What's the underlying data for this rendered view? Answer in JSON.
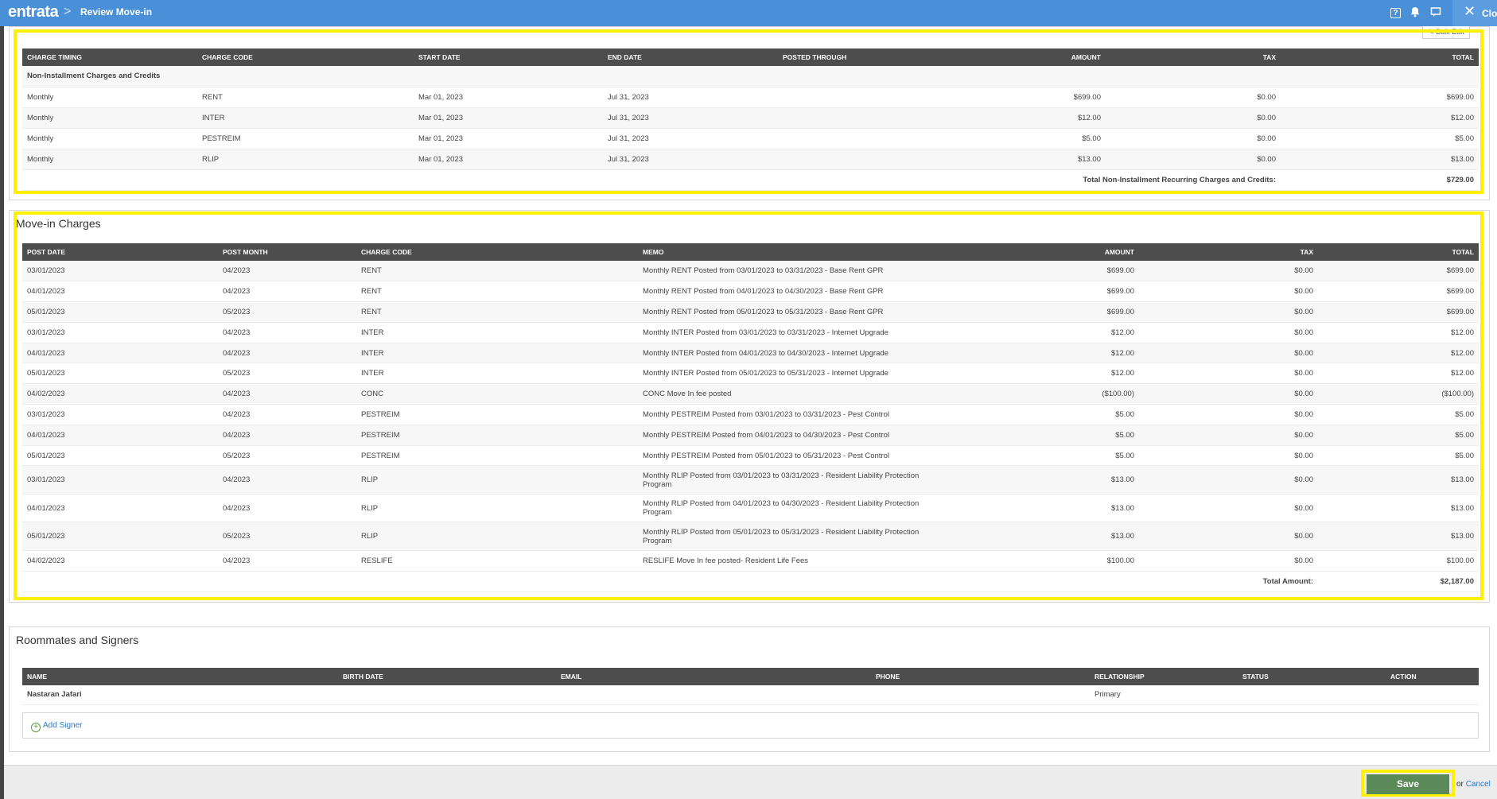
{
  "header": {
    "logo": "entrata",
    "separator": ">",
    "title": "Review Move-in",
    "help_icon": "?",
    "close_label": "Clo"
  },
  "bulk_edit": "Bulk Edit",
  "recurring": {
    "headers": [
      "CHARGE TIMING",
      "CHARGE CODE",
      "START DATE",
      "END DATE",
      "POSTED THROUGH",
      "AMOUNT",
      "TAX",
      "TOTAL"
    ],
    "group_label": "Non-Installment Charges and Credits",
    "rows": [
      [
        "Monthly",
        "RENT",
        "Mar 01, 2023",
        "Jul 31, 2023",
        "",
        "$699.00",
        "$0.00",
        "$699.00"
      ],
      [
        "Monthly",
        "INTER",
        "Mar 01, 2023",
        "Jul 31, 2023",
        "",
        "$12.00",
        "$0.00",
        "$12.00"
      ],
      [
        "Monthly",
        "PESTREIM",
        "Mar 01, 2023",
        "Jul 31, 2023",
        "",
        "$5.00",
        "$0.00",
        "$5.00"
      ],
      [
        "Monthly",
        "RLIP",
        "Mar 01, 2023",
        "Jul 31, 2023",
        "",
        "$13.00",
        "$0.00",
        "$13.00"
      ]
    ],
    "total_label": "Total Non-Installment Recurring Charges and Credits:",
    "total_value": "$729.00"
  },
  "move_in": {
    "title": "Move-in Charges",
    "headers": [
      "POST DATE",
      "POST MONTH",
      "CHARGE CODE",
      "MEMO",
      "AMOUNT",
      "TAX",
      "TOTAL"
    ],
    "rows": [
      [
        "03/01/2023",
        "04/2023",
        "RENT",
        "Monthly RENT Posted from 03/01/2023 to 03/31/2023 - Base Rent GPR",
        "$699.00",
        "$0.00",
        "$699.00"
      ],
      [
        "04/01/2023",
        "04/2023",
        "RENT",
        "Monthly RENT Posted from 04/01/2023 to 04/30/2023 - Base Rent GPR",
        "$699.00",
        "$0.00",
        "$699.00"
      ],
      [
        "05/01/2023",
        "05/2023",
        "RENT",
        "Monthly RENT Posted from 05/01/2023 to 05/31/2023 - Base Rent GPR",
        "$699.00",
        "$0.00",
        "$699.00"
      ],
      [
        "03/01/2023",
        "04/2023",
        "INTER",
        "Monthly INTER Posted from 03/01/2023 to 03/31/2023 - Internet Upgrade",
        "$12.00",
        "$0.00",
        "$12.00"
      ],
      [
        "04/01/2023",
        "04/2023",
        "INTER",
        "Monthly INTER Posted from 04/01/2023 to 04/30/2023 - Internet Upgrade",
        "$12.00",
        "$0.00",
        "$12.00"
      ],
      [
        "05/01/2023",
        "05/2023",
        "INTER",
        "Monthly INTER Posted from 05/01/2023 to 05/31/2023 - Internet Upgrade",
        "$12.00",
        "$0.00",
        "$12.00"
      ],
      [
        "04/02/2023",
        "04/2023",
        "CONC",
        "CONC Move In fee posted",
        "($100.00)",
        "$0.00",
        "($100.00)"
      ],
      [
        "03/01/2023",
        "04/2023",
        "PESTREIM",
        "Monthly PESTREIM Posted from 03/01/2023 to 03/31/2023 - Pest Control",
        "$5.00",
        "$0.00",
        "$5.00"
      ],
      [
        "04/01/2023",
        "04/2023",
        "PESTREIM",
        "Monthly PESTREIM Posted from 04/01/2023 to 04/30/2023 - Pest Control",
        "$5.00",
        "$0.00",
        "$5.00"
      ],
      [
        "05/01/2023",
        "05/2023",
        "PESTREIM",
        "Monthly PESTREIM Posted from 05/01/2023 to 05/31/2023 - Pest Control",
        "$5.00",
        "$0.00",
        "$5.00"
      ],
      [
        "03/01/2023",
        "04/2023",
        "RLIP",
        "Monthly RLIP Posted from 03/01/2023 to 03/31/2023 - Resident Liability Protection Program",
        "$13.00",
        "$0.00",
        "$13.00"
      ],
      [
        "04/01/2023",
        "04/2023",
        "RLIP",
        "Monthly RLIP Posted from 04/01/2023 to 04/30/2023 - Resident Liability Protection Program",
        "$13.00",
        "$0.00",
        "$13.00"
      ],
      [
        "05/01/2023",
        "05/2023",
        "RLIP",
        "Monthly RLIP Posted from 05/01/2023 to 05/31/2023 - Resident Liability Protection Program",
        "$13.00",
        "$0.00",
        "$13.00"
      ],
      [
        "04/02/2023",
        "04/2023",
        "RESLIFE",
        "RESLIFE Move In fee posted- Resident Life Fees",
        "$100.00",
        "$0.00",
        "$100.00"
      ]
    ],
    "total_label": "Total Amount:",
    "total_value": "$2,187.00"
  },
  "roommates": {
    "title": "Roommates and Signers",
    "headers": [
      "NAME",
      "BIRTH DATE",
      "EMAIL",
      "PHONE",
      "RELATIONSHIP",
      "STATUS",
      "ACTION"
    ],
    "rows": [
      [
        "Nastaran Jafari",
        "",
        "",
        "",
        "Primary",
        "",
        ""
      ]
    ],
    "add_signer": "Add Signer"
  },
  "footer": {
    "save": "Save",
    "or": "or",
    "cancel": "Cancel"
  }
}
